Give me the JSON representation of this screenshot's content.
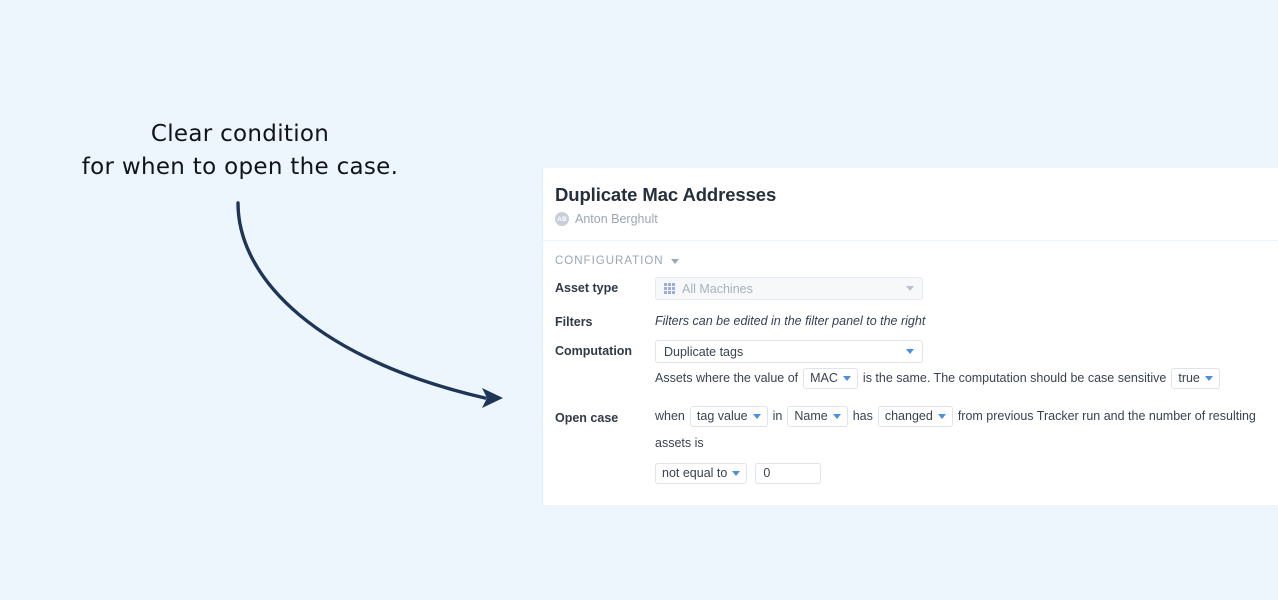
{
  "annotation": {
    "text": "Clear condition\nfor when to open the case.",
    "arrow_color": "#1d3557",
    "arrow_name": "curved-arrow"
  },
  "panel": {
    "title": "Duplicate Mac Addresses",
    "owner": {
      "initials": "AB",
      "name": "Anton Berghult"
    },
    "section": {
      "label": "CONFIGURATION"
    },
    "rows": {
      "asset_type": {
        "label": "Asset type",
        "value": "All Machines",
        "icon": "grid-icon",
        "disabled": true
      },
      "filters": {
        "label": "Filters",
        "note": "Filters can be edited in the filter panel to the right"
      },
      "computation": {
        "label": "Computation",
        "value": "Duplicate tags",
        "sentence": {
          "part1": "Assets where the value of",
          "tag": "MAC",
          "part2": "is the same. The computation should be case sensitive",
          "case_sensitive": "true"
        }
      },
      "open_case": {
        "label": "Open case",
        "sentence": {
          "w_when": "when",
          "subject": "tag value",
          "w_in": "in",
          "field": "Name",
          "w_has": "has",
          "change": "changed",
          "tail": "from previous Tracker run and the number of resulting assets is",
          "operator": "not equal to",
          "number": "0"
        }
      }
    }
  },
  "colors": {
    "page_background": "#eef6fd",
    "panel_background": "#ffffff",
    "accent_blue": "#4a8fe0",
    "title_text": "#26303c",
    "muted_text": "#9aa7b5"
  }
}
